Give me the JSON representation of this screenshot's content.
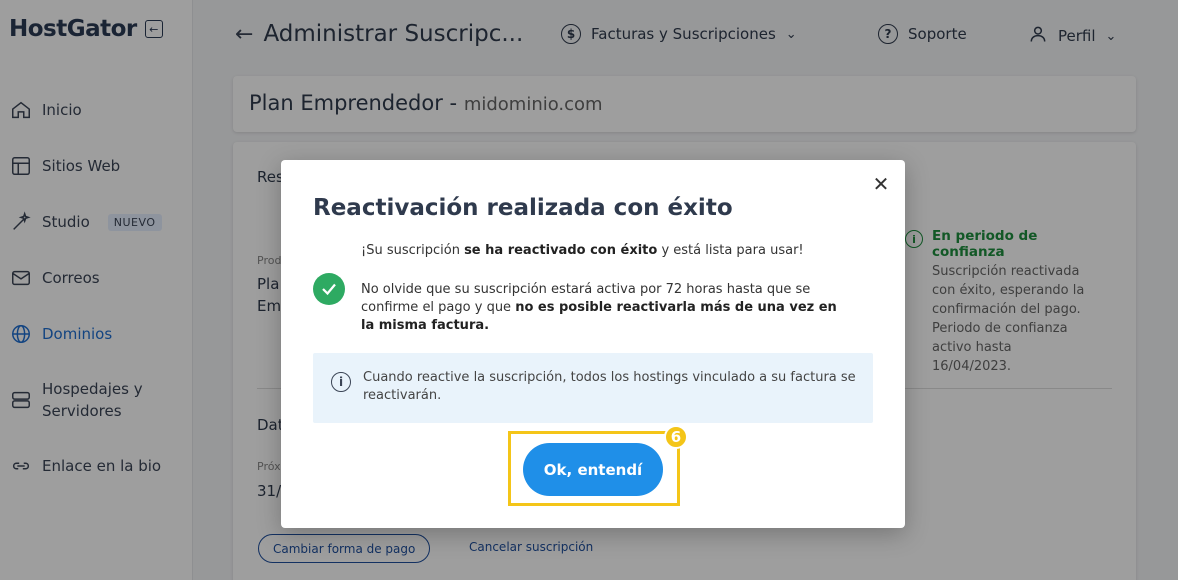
{
  "sidebar": {
    "logo": "HostGator",
    "items": [
      {
        "label": "Inicio",
        "icon": "home-icon"
      },
      {
        "label": "Sitios Web",
        "icon": "layout-icon"
      },
      {
        "label": "Studio",
        "icon": "magic-icon",
        "badge": "NUEVO"
      },
      {
        "label": "Correos",
        "icon": "mail-icon"
      },
      {
        "label": "Dominios",
        "icon": "globe-icon",
        "active": true
      },
      {
        "label": "Hospedajes y Servidores",
        "line1": "Hospedajes y",
        "line2": "Servidores",
        "icon": "server-icon"
      },
      {
        "label": "Enlace en la bio",
        "icon": "link-icon"
      }
    ]
  },
  "topbar": {
    "title": "Administrar Suscripc...",
    "billing": "Facturas y Suscripciones",
    "support": "Soporte",
    "profile": "Perfil"
  },
  "plan": {
    "name": "Plan Emprendedor - ",
    "domain": "midominio.com"
  },
  "background": {
    "section1": "Res",
    "product_label": "Prod",
    "product_value_1": "Pla",
    "product_value_2": "Em",
    "status_title": "En periodo de confianza",
    "status_desc": "Suscripción reactivada con éxito, esperando la confirmación del pago. Periodo de confianza activo hasta 16/04/2023.",
    "section2": "Dat",
    "next_label": "Próx",
    "next_value": "31/0",
    "change_payment": "Cambiar forma de pago",
    "cancel_subscription": "Cancelar suscripción"
  },
  "modal": {
    "title": "Reactivación realizada con éxito",
    "msg1_a": "¡Su suscripción ",
    "msg1_b": "se ha reactivado con éxito",
    "msg1_c": " y está lista para usar!",
    "msg2_a": "No olvide que su suscripción estará activa por 72 horas hasta que se confirme el pago y que ",
    "msg2_b": "no es posible reactivarla más de una vez en la misma factura.",
    "info": "Cuando reactive la suscripción, todos los hostings vinculado a su factura se reactivarán.",
    "ok_button": "Ok, entendí",
    "step_number": "6"
  },
  "colors": {
    "accent": "#1f8fe8",
    "success": "#2eaa62",
    "highlight": "#f4c518",
    "active_nav": "#1f6fd1"
  }
}
